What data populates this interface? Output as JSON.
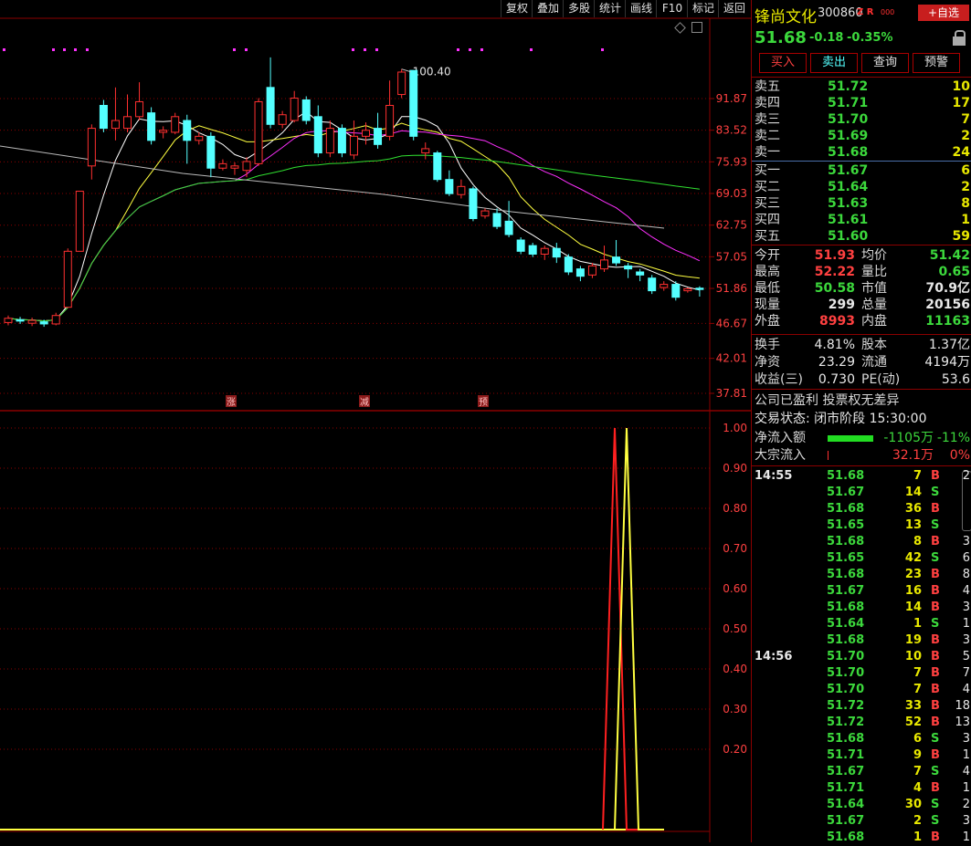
{
  "toolbar": [
    "复权",
    "叠加",
    "多股",
    "统计",
    "画线",
    "F10",
    "标记",
    "返回"
  ],
  "chart_data": {
    "type": "candlestick",
    "high_label": "100.40",
    "price_axis": [
      "91.87",
      "83.52",
      "75.93",
      "69.03",
      "62.75",
      "57.05",
      "51.86",
      "46.67",
      "42.01",
      "37.81"
    ],
    "indicator_axis": [
      "1.00",
      "0.90",
      "0.80",
      "0.70",
      "0.60",
      "0.50",
      "0.40",
      "0.30",
      "0.20"
    ],
    "markers": [
      "涨",
      "减",
      "预"
    ],
    "candles": [
      {
        "o": 46.8,
        "c": 47.4,
        "h": 47.8,
        "l": 46.4
      },
      {
        "o": 47.2,
        "c": 47.0,
        "h": 47.6,
        "l": 46.6
      },
      {
        "o": 46.7,
        "c": 47.1,
        "h": 47.5,
        "l": 46.3
      },
      {
        "o": 46.9,
        "c": 46.6,
        "h": 47.2,
        "l": 46.2
      },
      {
        "o": 46.6,
        "c": 47.8,
        "h": 48.2,
        "l": 46.4
      },
      {
        "o": 49.0,
        "c": 58.0,
        "h": 58.5,
        "l": 49.0
      },
      {
        "o": 58.0,
        "c": 69.5,
        "h": 69.5,
        "l": 58.0
      },
      {
        "o": 75.0,
        "c": 84.0,
        "h": 85.0,
        "l": 72.0
      },
      {
        "o": 90.0,
        "c": 84.0,
        "h": 91.5,
        "l": 83.0
      },
      {
        "o": 84.0,
        "c": 86.0,
        "h": 95.0,
        "l": 81.0
      },
      {
        "o": 84.0,
        "c": 87.0,
        "h": 93.0,
        "l": 83.0
      },
      {
        "o": 87.0,
        "c": 91.0,
        "h": 96.5,
        "l": 86.0
      },
      {
        "o": 88.0,
        "c": 81.0,
        "h": 89.5,
        "l": 80.0
      },
      {
        "o": 83.0,
        "c": 83.5,
        "h": 84.5,
        "l": 81.5
      },
      {
        "o": 83.0,
        "c": 87.0,
        "h": 88.0,
        "l": 82.5
      },
      {
        "o": 86.0,
        "c": 81.0,
        "h": 87.5,
        "l": 75.5
      },
      {
        "o": 81.0,
        "c": 82.0,
        "h": 83.0,
        "l": 80.0
      },
      {
        "o": 82.0,
        "c": 74.5,
        "h": 83.0,
        "l": 72.5
      },
      {
        "o": 74.5,
        "c": 75.5,
        "h": 76.5,
        "l": 74.0
      },
      {
        "o": 74.5,
        "c": 75.0,
        "h": 75.8,
        "l": 73.0
      },
      {
        "o": 74.0,
        "c": 76.0,
        "h": 77.0,
        "l": 72.5
      },
      {
        "o": 75.5,
        "c": 91.0,
        "h": 92.0,
        "l": 75.0
      },
      {
        "o": 95.0,
        "c": 85.0,
        "h": 104.0,
        "l": 84.0
      },
      {
        "o": 85.0,
        "c": 87.5,
        "h": 88.5,
        "l": 84.0
      },
      {
        "o": 86.0,
        "c": 92.0,
        "h": 94.0,
        "l": 85.5
      },
      {
        "o": 91.5,
        "c": 86.0,
        "h": 92.5,
        "l": 85.0
      },
      {
        "o": 87.0,
        "c": 78.0,
        "h": 90.0,
        "l": 77.0
      },
      {
        "o": 78.0,
        "c": 84.0,
        "h": 86.0,
        "l": 77.0
      },
      {
        "o": 84.0,
        "c": 78.0,
        "h": 85.0,
        "l": 77.0
      },
      {
        "o": 77.5,
        "c": 82.0,
        "h": 86.0,
        "l": 76.5
      },
      {
        "o": 82.0,
        "c": 83.5,
        "h": 85.5,
        "l": 80.0
      },
      {
        "o": 84.0,
        "c": 80.0,
        "h": 88.0,
        "l": 79.0
      },
      {
        "o": 82.0,
        "c": 90.0,
        "h": 97.0,
        "l": 81.0
      },
      {
        "o": 93.0,
        "c": 99.5,
        "h": 100.4,
        "l": 92.0
      },
      {
        "o": 100.0,
        "c": 82.0,
        "h": 100.0,
        "l": 81.0
      },
      {
        "o": 78.0,
        "c": 79.0,
        "h": 80.5,
        "l": 76.5
      },
      {
        "o": 78.0,
        "c": 72.0,
        "h": 78.5,
        "l": 71.5
      },
      {
        "o": 72.0,
        "c": 69.0,
        "h": 74.0,
        "l": 68.5
      },
      {
        "o": 68.8,
        "c": 70.5,
        "h": 72.0,
        "l": 68.0
      },
      {
        "o": 70.0,
        "c": 64.0,
        "h": 70.5,
        "l": 63.5
      },
      {
        "o": 64.5,
        "c": 65.5,
        "h": 66.0,
        "l": 64.0
      },
      {
        "o": 65.0,
        "c": 62.5,
        "h": 66.0,
        "l": 62.0
      },
      {
        "o": 63.5,
        "c": 61.0,
        "h": 67.5,
        "l": 60.5
      },
      {
        "o": 60.0,
        "c": 58.0,
        "h": 60.5,
        "l": 57.5
      },
      {
        "o": 59.0,
        "c": 57.5,
        "h": 59.5,
        "l": 57.0
      },
      {
        "o": 57.5,
        "c": 58.5,
        "h": 59.0,
        "l": 56.5
      },
      {
        "o": 58.5,
        "c": 57.0,
        "h": 59.5,
        "l": 56.0
      },
      {
        "o": 57.0,
        "c": 54.5,
        "h": 57.5,
        "l": 54.0
      },
      {
        "o": 55.0,
        "c": 53.8,
        "h": 55.5,
        "l": 53.0
      },
      {
        "o": 54.0,
        "c": 55.5,
        "h": 56.0,
        "l": 53.5
      },
      {
        "o": 55.0,
        "c": 56.5,
        "h": 59.0,
        "l": 54.5
      },
      {
        "o": 57.0,
        "c": 56.0,
        "h": 60.0,
        "l": 55.5
      },
      {
        "o": 55.5,
        "c": 55.0,
        "h": 56.0,
        "l": 53.5
      },
      {
        "o": 54.5,
        "c": 54.0,
        "h": 55.0,
        "l": 53.0
      },
      {
        "o": 53.5,
        "c": 51.5,
        "h": 54.0,
        "l": 51.0
      },
      {
        "o": 52.0,
        "c": 52.5,
        "h": 53.0,
        "l": 51.5
      },
      {
        "o": 52.5,
        "c": 50.5,
        "h": 53.0,
        "l": 50.0
      },
      {
        "o": 51.5,
        "c": 51.8,
        "h": 52.0,
        "l": 51.2
      },
      {
        "o": 51.9,
        "c": 51.7,
        "h": 52.2,
        "l": 50.6
      }
    ]
  },
  "header": {
    "name": "锋尚文化",
    "code": "300860",
    "tag": "Z R",
    "tag2": "000",
    "add_btn": "+自选"
  },
  "quote": {
    "price": "51.68",
    "change": "-0.18",
    "pct": "-0.35%"
  },
  "buttons": [
    "买入",
    "卖出",
    "查询",
    "预警"
  ],
  "sell": [
    {
      "label": "卖五",
      "price": "51.72",
      "vol": "10"
    },
    {
      "label": "卖四",
      "price": "51.71",
      "vol": "17"
    },
    {
      "label": "卖三",
      "price": "51.70",
      "vol": "7"
    },
    {
      "label": "卖二",
      "price": "51.69",
      "vol": "2"
    },
    {
      "label": "卖一",
      "price": "51.68",
      "vol": "24"
    }
  ],
  "buy": [
    {
      "label": "买一",
      "price": "51.67",
      "vol": "6"
    },
    {
      "label": "买二",
      "price": "51.64",
      "vol": "2"
    },
    {
      "label": "买三",
      "price": "51.63",
      "vol": "8"
    },
    {
      "label": "买四",
      "price": "51.61",
      "vol": "1"
    },
    {
      "label": "买五",
      "price": "51.60",
      "vol": "59"
    }
  ],
  "stats": [
    {
      "l1": "今开",
      "v1": "51.93",
      "c1": "r",
      "l2": "均价",
      "v2": "51.42",
      "c2": "g"
    },
    {
      "l1": "最高",
      "v1": "52.22",
      "c1": "r",
      "l2": "量比",
      "v2": "0.65",
      "c2": "g"
    },
    {
      "l1": "最低",
      "v1": "50.58",
      "c1": "g",
      "l2": "市值",
      "v2": "70.9亿",
      "c2": "w"
    },
    {
      "l1": "现量",
      "v1": "299",
      "c1": "w",
      "l2": "总量",
      "v2": "20156",
      "c2": "w"
    },
    {
      "l1": "外盘",
      "v1": "8993",
      "c1": "r",
      "l2": "内盘",
      "v2": "11163",
      "c2": "g"
    }
  ],
  "stats2": [
    {
      "l1": "换手",
      "v1": "4.81%",
      "c1": "w",
      "l2": "股本",
      "v2": "1.37亿",
      "c2": "w"
    },
    {
      "l1": "净资",
      "v1": "23.29",
      "c1": "w",
      "l2": "流通",
      "v2": "4194万",
      "c2": "w"
    },
    {
      "l1": "收益(三)",
      "v1": "0.730",
      "c1": "w",
      "l2": "PE(动)",
      "v2": "53.6",
      "c2": "w"
    }
  ],
  "info": {
    "line1": "公司已盈利 投票权无差异",
    "line2": "交易状态: 闭市阶段 15:30:00"
  },
  "flow": [
    {
      "label": "净流入额",
      "v1": "-1105万",
      "v2": "-11%",
      "c": "g"
    },
    {
      "label": "大宗流入",
      "v1": "32.1万",
      "v2": "0%",
      "c": "r"
    }
  ],
  "trades": [
    {
      "t": "14:55",
      "p": "51.68",
      "v": "7",
      "s": "B",
      "n": "2"
    },
    {
      "t": "",
      "p": "51.67",
      "v": "14",
      "s": "S",
      "n": ""
    },
    {
      "t": "",
      "p": "51.68",
      "v": "36",
      "s": "B",
      "n": ""
    },
    {
      "t": "",
      "p": "51.65",
      "v": "13",
      "s": "S",
      "n": ""
    },
    {
      "t": "",
      "p": "51.68",
      "v": "8",
      "s": "B",
      "n": "3"
    },
    {
      "t": "",
      "p": "51.65",
      "v": "42",
      "s": "S",
      "n": "6"
    },
    {
      "t": "",
      "p": "51.68",
      "v": "23",
      "s": "B",
      "n": "8"
    },
    {
      "t": "",
      "p": "51.67",
      "v": "16",
      "s": "B",
      "n": "4"
    },
    {
      "t": "",
      "p": "51.68",
      "v": "14",
      "s": "B",
      "n": "3"
    },
    {
      "t": "",
      "p": "51.64",
      "v": "1",
      "s": "S",
      "n": "1"
    },
    {
      "t": "",
      "p": "51.68",
      "v": "19",
      "s": "B",
      "n": "3"
    },
    {
      "t": "14:56",
      "p": "51.70",
      "v": "10",
      "s": "B",
      "n": "5"
    },
    {
      "t": "",
      "p": "51.70",
      "v": "7",
      "s": "B",
      "n": "7"
    },
    {
      "t": "",
      "p": "51.70",
      "v": "7",
      "s": "B",
      "n": "4"
    },
    {
      "t": "",
      "p": "51.72",
      "v": "33",
      "s": "B",
      "n": "18"
    },
    {
      "t": "",
      "p": "51.72",
      "v": "52",
      "s": "B",
      "n": "13"
    },
    {
      "t": "",
      "p": "51.68",
      "v": "6",
      "s": "S",
      "n": "3"
    },
    {
      "t": "",
      "p": "51.71",
      "v": "9",
      "s": "B",
      "n": "1"
    },
    {
      "t": "",
      "p": "51.67",
      "v": "7",
      "s": "S",
      "n": "4"
    },
    {
      "t": "",
      "p": "51.71",
      "v": "4",
      "s": "B",
      "n": "1"
    },
    {
      "t": "",
      "p": "51.64",
      "v": "30",
      "s": "S",
      "n": "2"
    },
    {
      "t": "",
      "p": "51.67",
      "v": "2",
      "s": "S",
      "n": "3"
    },
    {
      "t": "",
      "p": "51.68",
      "v": "1",
      "s": "B",
      "n": "1"
    }
  ],
  "colors": {
    "up": "#ff3030",
    "down": "#54ffff",
    "bg": "#000000",
    "frame": "#8b0000"
  }
}
